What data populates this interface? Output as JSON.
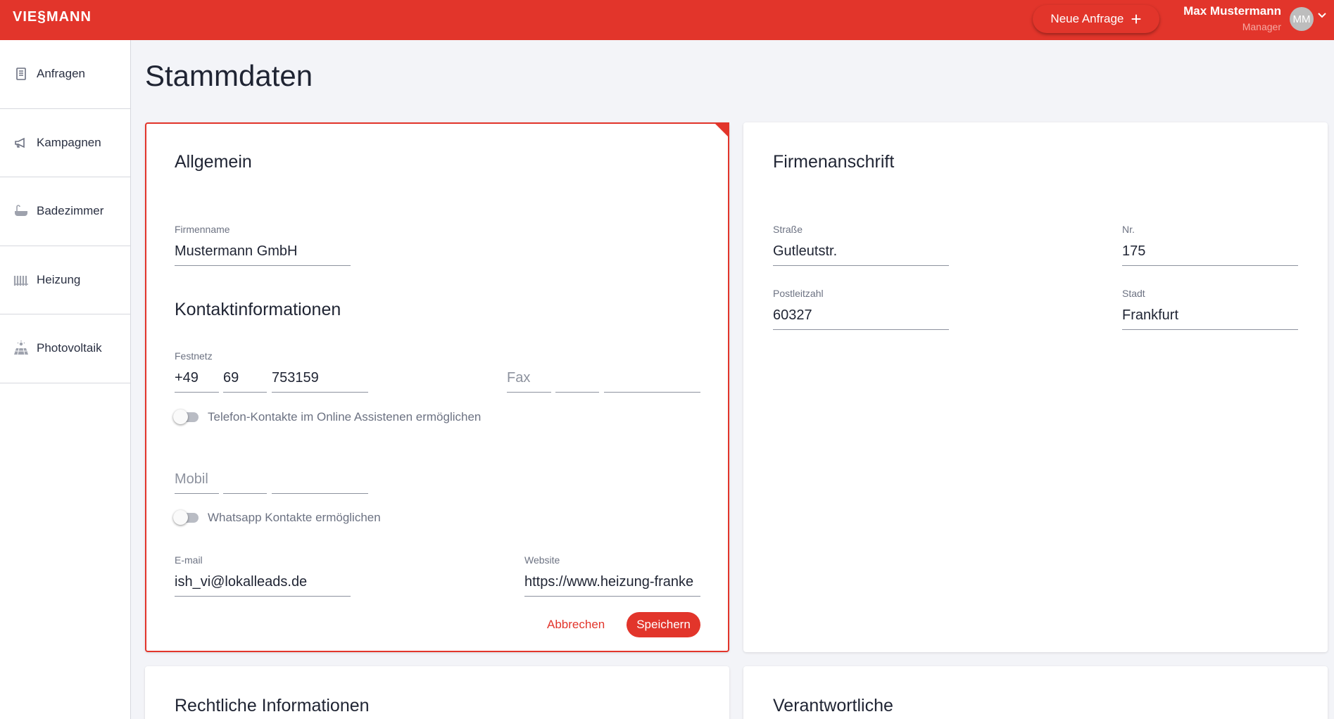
{
  "header": {
    "logo": "VIE$MANN",
    "new_request": "Neue Anfrage",
    "user_name": "Max Mustermann",
    "user_role": "Manager",
    "avatar_initials": "MM"
  },
  "sidebar": {
    "items": [
      {
        "label": "Anfragen",
        "icon": "document-icon"
      },
      {
        "label": "Kampagnen",
        "icon": "megaphone-icon"
      },
      {
        "label": "Badezimmer",
        "icon": "bathtub-icon"
      },
      {
        "label": "Heizung",
        "icon": "radiator-icon"
      },
      {
        "label": "Photovoltaik",
        "icon": "solar-panel-icon"
      }
    ]
  },
  "page": {
    "title": "Stammdaten"
  },
  "general": {
    "title": "Allgemein",
    "company_label": "Firmenname",
    "company_value": "Mustermann GmbH",
    "contact_title": "Kontaktinformationen",
    "landline_label": "Festnetz",
    "landline_country": "+49",
    "landline_area": "69",
    "landline_number": "753159",
    "fax_placeholder": "Fax",
    "phone_toggle_label": "Telefon-Kontakte im Online Assistenen ermöglichen",
    "mobile_placeholder": "Mobil",
    "whatsapp_toggle_label": "Whatsapp Kontakte ermöglichen",
    "email_label": "E-mail",
    "email_value": "ish_vi@lokalleads.de",
    "website_label": "Website",
    "website_value": "https://www.heizung-franke",
    "cancel": "Abbrechen",
    "save": "Speichern"
  },
  "address": {
    "title": "Firmenanschrift",
    "street_label": "Straße",
    "street_value": "Gutleutstr.",
    "number_label": "Nr.",
    "number_value": "175",
    "zip_label": "Postleitzahl",
    "zip_value": "60327",
    "city_label": "Stadt",
    "city_value": "Frankfurt"
  },
  "legal": {
    "title": "Rechtliche Informationen"
  },
  "responsible": {
    "title": "Verantwortliche"
  },
  "colors": {
    "accent": "#e2352b",
    "background": "#f3f4f8"
  }
}
